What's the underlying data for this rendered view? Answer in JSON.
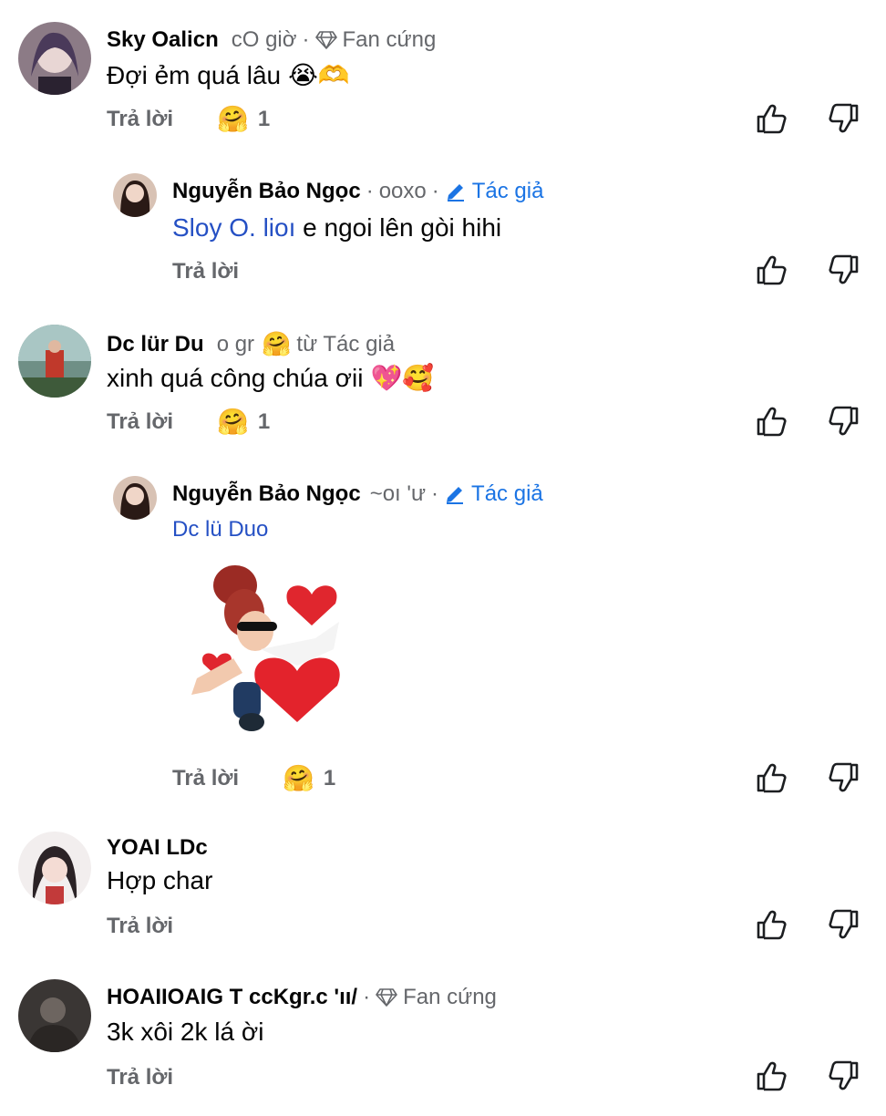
{
  "comments": [
    {
      "name": "Sky Oalicn",
      "time": "cO giờ",
      "badge": "Fan cứng",
      "text": "Đợi ẻm quá lâu",
      "emojis": "😭🫶",
      "reply": "Trả lời",
      "reaction_emoji": "🤗",
      "reaction_count": "1"
    },
    {
      "name": "Nguyễn Bảo Ngọc",
      "time": "ooxo",
      "badge": "Tác giả",
      "mention": "Sloy O. lioı",
      "text": " e ngoi lên gòi hihi",
      "reply": "Trả lời"
    },
    {
      "name": "Dc lür Du",
      "time": "o gr",
      "reacted_emoji": "🤗",
      "reacted_label": "từ Tác giả",
      "text": "xinh quá công chúa ơii",
      "emojis": "💖🥰",
      "reply": "Trả lời",
      "reaction_emoji": "🤗",
      "reaction_count": "1"
    },
    {
      "name": "Nguyễn Bảo Ngọc",
      "time": "~oı 'ư",
      "badge": "Tác giả",
      "mention": "Dc lü Duo",
      "reply": "Trả lời",
      "reaction_emoji": "🤗",
      "reaction_count": "1"
    },
    {
      "name": "YOAI LDc",
      "text": "Hợp char",
      "reply": "Trả lời"
    },
    {
      "name": "HOAIIOAIG T ccKgr.c 'ıı/",
      "badge": "Fan cứng",
      "text": "3k xôi 2k lá ời",
      "reply": "Trả lời"
    }
  ],
  "icons": {
    "like": "thumbs-up-icon",
    "dislike": "thumbs-down-icon",
    "fan": "diamond-icon",
    "author": "pencil-icon"
  },
  "colors": {
    "author": "#1b74e4",
    "mention": "#2550c4",
    "secondary": "#65676b"
  }
}
